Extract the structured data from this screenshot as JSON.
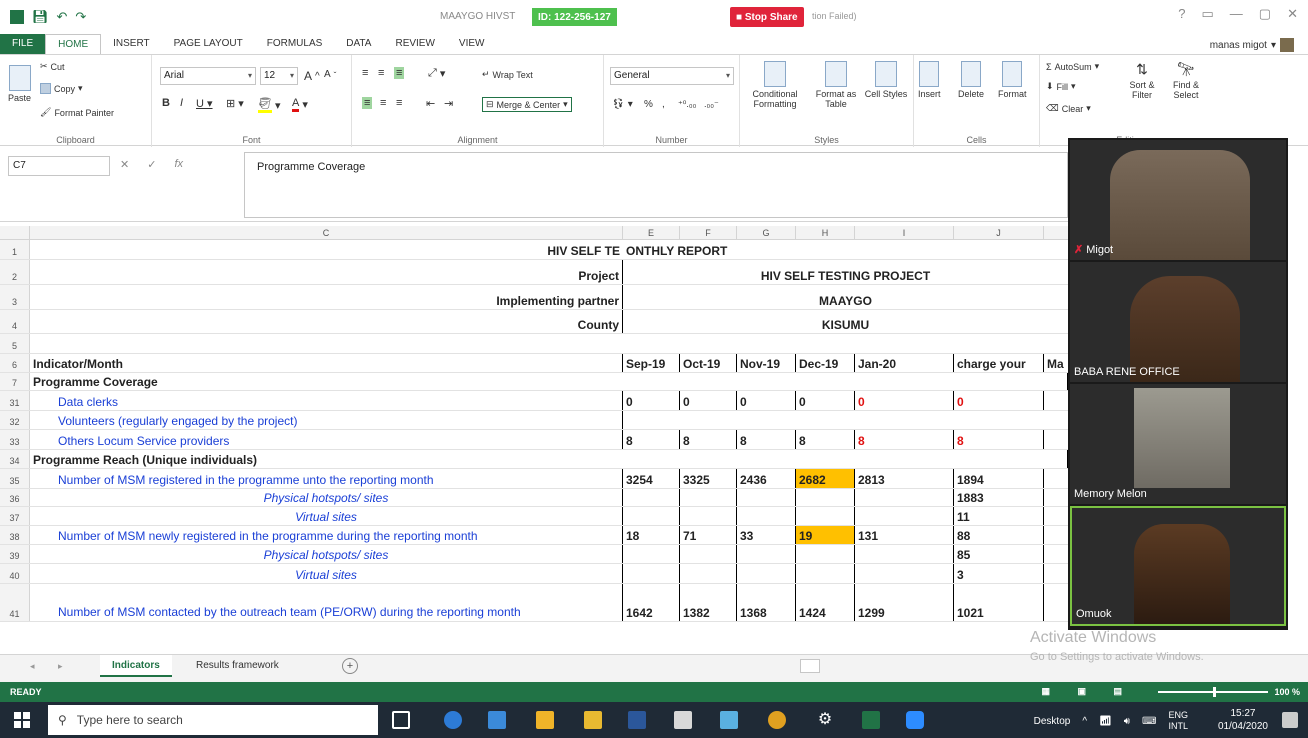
{
  "app": {
    "doc_title": "MAAYGO HIVST",
    "share_id": "ID: 122-256-127",
    "stop_share": "Stop Share",
    "share_status": "tion Failed)",
    "window_controls": [
      "?",
      "▭",
      "—",
      "▢",
      "✕"
    ]
  },
  "tabs": [
    "FILE",
    "HOME",
    "INSERT",
    "PAGE LAYOUT",
    "FORMULAS",
    "DATA",
    "REVIEW",
    "VIEW"
  ],
  "active_tab": "HOME",
  "user": "manas migot",
  "ribbon": {
    "clipboard": {
      "label": "Clipboard",
      "paste": "Paste",
      "cut": "Cut",
      "copy": "Copy",
      "painter": "Format Painter"
    },
    "font": {
      "label": "Font",
      "family": "Arial",
      "size": "12"
    },
    "alignment": {
      "label": "Alignment",
      "wrap": "Wrap Text",
      "merge": "Merge & Center"
    },
    "number": {
      "label": "Number",
      "format": "General"
    },
    "styles": {
      "label": "Styles",
      "conditional": "Conditional Formatting",
      "format_table": "Format as Table",
      "cell_styles": "Cell Styles"
    },
    "cells": {
      "label": "Cells",
      "insert": "Insert",
      "delete": "Delete",
      "format": "Format"
    },
    "editing": {
      "label": "Editing",
      "autosum": "AutoSum",
      "fill": "Fill",
      "clear": "Clear",
      "sort": "Sort & Filter",
      "find": "Find & Select"
    }
  },
  "formula_bar": {
    "cell_ref": "C7",
    "content": "Programme Coverage"
  },
  "columns": [
    {
      "name": "C"
    },
    {
      "name": "E"
    },
    {
      "name": "F"
    },
    {
      "name": "G"
    },
    {
      "name": "H"
    },
    {
      "name": "I"
    },
    {
      "name": "J"
    }
  ],
  "rows": [
    {
      "num": "1",
      "cells": [
        {
          "text": "HIV SELF TE",
          "cls": "bold right nob"
        },
        {
          "text": "ONTHLY REPORT",
          "cls": "bold nob"
        }
      ]
    },
    {
      "num": "2",
      "cells": [
        {
          "text": "Project",
          "cls": "bold right"
        },
        {
          "text": "HIV SELF TESTING PROJECT",
          "cls": "bold center nob"
        }
      ]
    },
    {
      "num": "3",
      "cells": [
        {
          "text": "Implementing partner",
          "cls": "bold right"
        },
        {
          "text": "MAAYGO",
          "cls": "bold center nob"
        }
      ]
    },
    {
      "num": "4",
      "cells": [
        {
          "text": "County",
          "cls": "bold right"
        },
        {
          "text": "KISUMU",
          "cls": "bold center nob"
        }
      ]
    },
    {
      "num": "5",
      "cells": []
    },
    {
      "num": "6",
      "cells": [
        {
          "text": "Indicator/Month",
          "cls": "bold"
        },
        {
          "text": "Sep-19",
          "cls": "bold"
        },
        {
          "text": "Oct-19",
          "cls": "bold"
        },
        {
          "text": "Nov-19",
          "cls": "bold"
        },
        {
          "text": "Dec-19",
          "cls": "bold"
        },
        {
          "text": "Jan-20",
          "cls": "bold"
        },
        {
          "text": "charge your",
          "cls": "bold"
        },
        {
          "text": "Ma",
          "cls": "bold nob"
        }
      ]
    },
    {
      "num": "7",
      "cells": [
        {
          "text": "Programme Coverage",
          "cls": "bold"
        }
      ]
    },
    {
      "num": "31",
      "cells": [
        {
          "text": "Data clerks",
          "cls": "blue indent"
        },
        {
          "text": "0",
          "cls": "bold"
        },
        {
          "text": "0",
          "cls": "bold"
        },
        {
          "text": "0",
          "cls": "bold"
        },
        {
          "text": "0",
          "cls": "bold"
        },
        {
          "text": "0",
          "cls": "bold red"
        },
        {
          "text": "0",
          "cls": "bold red"
        }
      ]
    },
    {
      "num": "32",
      "cells": [
        {
          "text": "Volunteers (regularly engaged by the project)",
          "cls": "blue indent"
        }
      ]
    },
    {
      "num": "33",
      "cells": [
        {
          "text": "Others Locum Service providers",
          "cls": "blue indent"
        },
        {
          "text": "8",
          "cls": "bold"
        },
        {
          "text": "8",
          "cls": "bold"
        },
        {
          "text": "8",
          "cls": "bold"
        },
        {
          "text": "8",
          "cls": "bold"
        },
        {
          "text": "8",
          "cls": "bold red"
        },
        {
          "text": "8",
          "cls": "bold red"
        }
      ]
    },
    {
      "num": "34",
      "cells": [
        {
          "text": "Programme Reach (Unique individuals)",
          "cls": "bold"
        }
      ]
    },
    {
      "num": "35",
      "cells": [
        {
          "text": "Number of MSM registered in the programme unto the reporting month",
          "cls": "blue indent"
        },
        {
          "text": "3254",
          "cls": "bold"
        },
        {
          "text": "3325",
          "cls": "bold"
        },
        {
          "text": "2436",
          "cls": "bold"
        },
        {
          "text": "2682",
          "cls": "bold hl"
        },
        {
          "text": "2813",
          "cls": "bold"
        },
        {
          "text": "1894",
          "cls": "bold"
        }
      ]
    },
    {
      "num": "36",
      "cells": [
        {
          "text": "Physical hotspots/ sites",
          "cls": "blue italic center"
        },
        {
          "text": "",
          "cls": ""
        },
        {
          "text": "",
          "cls": ""
        },
        {
          "text": "",
          "cls": ""
        },
        {
          "text": "",
          "cls": ""
        },
        {
          "text": "",
          "cls": ""
        },
        {
          "text": "1883",
          "cls": "bold"
        }
      ]
    },
    {
      "num": "37",
      "cells": [
        {
          "text": "Virtual sites",
          "cls": "blue italic center"
        },
        {
          "text": "",
          "cls": ""
        },
        {
          "text": "",
          "cls": ""
        },
        {
          "text": "",
          "cls": ""
        },
        {
          "text": "",
          "cls": ""
        },
        {
          "text": "",
          "cls": ""
        },
        {
          "text": "11",
          "cls": "bold"
        }
      ]
    },
    {
      "num": "38",
      "cells": [
        {
          "text": "Number of MSM newly registered in the programme during the reporting month",
          "cls": "blue indent"
        },
        {
          "text": "18",
          "cls": "bold"
        },
        {
          "text": "71",
          "cls": "bold"
        },
        {
          "text": "33",
          "cls": "bold"
        },
        {
          "text": "19",
          "cls": "bold hl"
        },
        {
          "text": "131",
          "cls": "bold"
        },
        {
          "text": "88",
          "cls": "bold"
        }
      ]
    },
    {
      "num": "39",
      "cells": [
        {
          "text": "Physical hotspots/ sites",
          "cls": "blue italic center"
        },
        {
          "text": "",
          "cls": ""
        },
        {
          "text": "",
          "cls": ""
        },
        {
          "text": "",
          "cls": ""
        },
        {
          "text": "",
          "cls": ""
        },
        {
          "text": "",
          "cls": ""
        },
        {
          "text": "85",
          "cls": "bold"
        }
      ]
    },
    {
      "num": "40",
      "cells": [
        {
          "text": "Virtual sites",
          "cls": "blue italic center"
        },
        {
          "text": "",
          "cls": ""
        },
        {
          "text": "",
          "cls": ""
        },
        {
          "text": "",
          "cls": ""
        },
        {
          "text": "",
          "cls": ""
        },
        {
          "text": "",
          "cls": ""
        },
        {
          "text": "3",
          "cls": "bold"
        }
      ]
    },
    {
      "num": "41",
      "cells": [
        {
          "text": "Number of MSM  contacted by the outreach team (PE/ORW) during the reporting month",
          "cls": "blue indent wrap"
        },
        {
          "text": "1642",
          "cls": "bold"
        },
        {
          "text": "1382",
          "cls": "bold"
        },
        {
          "text": "1368",
          "cls": "bold"
        },
        {
          "text": "1424",
          "cls": "bold"
        },
        {
          "text": "1299",
          "cls": "bold"
        },
        {
          "text": "1021",
          "cls": "bold"
        }
      ]
    }
  ],
  "sheets": [
    {
      "name": "Indicators",
      "active": true
    },
    {
      "name": "Results framework",
      "active": false
    }
  ],
  "activate": {
    "title": "Activate Windows",
    "subtitle": "Go to Settings to activate Windows."
  },
  "status": {
    "ready": "READY",
    "zoom": "100 %"
  },
  "participants": [
    {
      "name": "Migot",
      "muted": true
    },
    {
      "name": "BABA RENE OFFICE",
      "muted": false
    },
    {
      "name": "Memory Melon",
      "muted": false
    },
    {
      "name": "Omuok",
      "muted": false,
      "speaking": true
    }
  ],
  "taskbar": {
    "search_placeholder": "Type here to search",
    "desktop": "Desktop",
    "lang": "ENG",
    "layout": "INTL",
    "time": "15:27",
    "date": "01/04/2020"
  }
}
